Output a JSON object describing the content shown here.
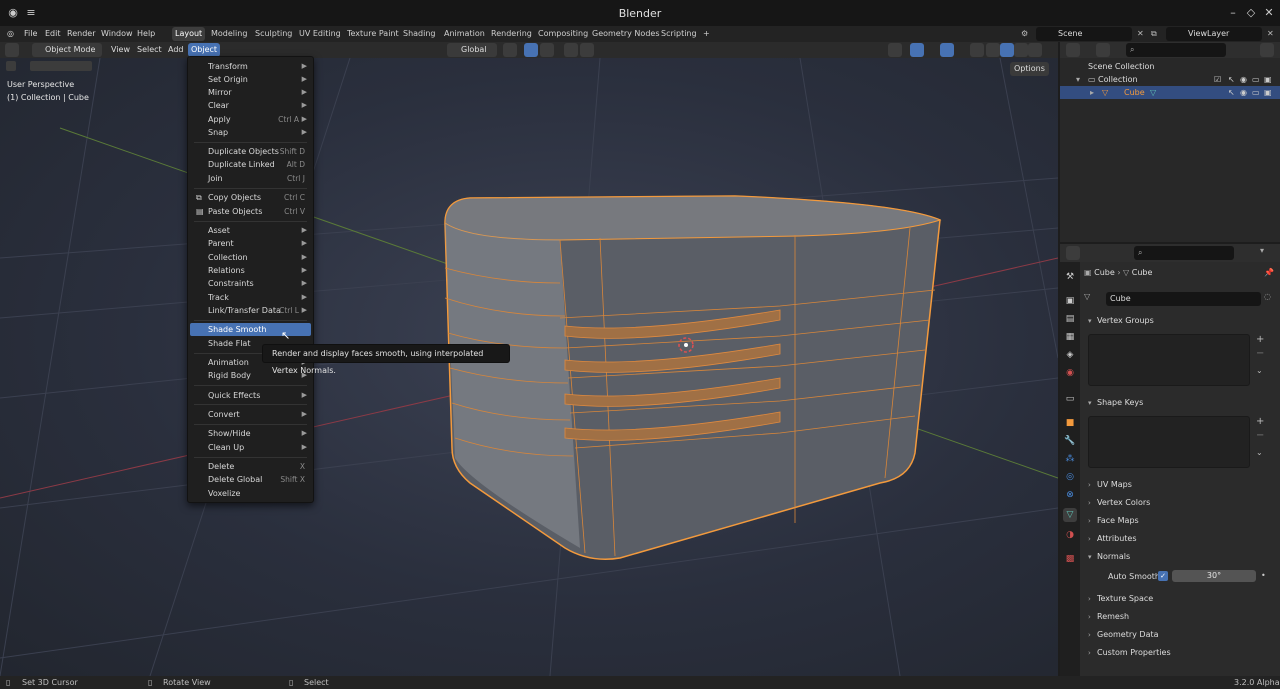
{
  "window": {
    "title": "Blender"
  },
  "menubar": {
    "items": [
      "File",
      "Edit",
      "Render",
      "Window",
      "Help"
    ],
    "workspaces": [
      "Layout",
      "Modeling",
      "Sculpting",
      "UV Editing",
      "Texture Paint",
      "Shading",
      "Animation",
      "Rendering",
      "Compositing",
      "Geometry Nodes",
      "Scripting"
    ],
    "active_workspace": "Layout",
    "add_tab": "+",
    "scene": "Scene",
    "view_layer": "ViewLayer"
  },
  "viewport_header": {
    "mode": "Object Mode",
    "menus": [
      "View",
      "Select",
      "Add",
      "Object"
    ],
    "active_menu": "Object",
    "orientation": "Global",
    "options": "Options"
  },
  "viewport": {
    "perspective": "User Perspective",
    "context": "(1) Collection | Cube"
  },
  "object_menu": {
    "items": [
      {
        "label": "Transform",
        "shortcut": "",
        "submenu": true
      },
      {
        "label": "Set Origin",
        "shortcut": "",
        "submenu": true
      },
      {
        "label": "Mirror",
        "shortcut": "",
        "submenu": true
      },
      {
        "label": "Clear",
        "shortcut": "",
        "submenu": true
      },
      {
        "label": "Apply",
        "shortcut": "Ctrl A",
        "submenu": true
      },
      {
        "label": "Snap",
        "shortcut": "",
        "submenu": true
      },
      {
        "label": "Duplicate Objects",
        "shortcut": "Shift D",
        "submenu": false
      },
      {
        "label": "Duplicate Linked",
        "shortcut": "Alt D",
        "submenu": false
      },
      {
        "label": "Join",
        "shortcut": "Ctrl J",
        "submenu": false
      },
      {
        "label": "Copy Objects",
        "shortcut": "Ctrl C",
        "submenu": false
      },
      {
        "label": "Paste Objects",
        "shortcut": "Ctrl V",
        "submenu": false
      },
      {
        "label": "Asset",
        "shortcut": "",
        "submenu": true
      },
      {
        "label": "Parent",
        "shortcut": "",
        "submenu": true
      },
      {
        "label": "Collection",
        "shortcut": "",
        "submenu": true
      },
      {
        "label": "Relations",
        "shortcut": "",
        "submenu": true
      },
      {
        "label": "Constraints",
        "shortcut": "",
        "submenu": true
      },
      {
        "label": "Track",
        "shortcut": "",
        "submenu": true
      },
      {
        "label": "Link/Transfer Data",
        "shortcut": "Ctrl L",
        "submenu": true
      },
      {
        "label": "Shade Smooth",
        "shortcut": "",
        "submenu": false
      },
      {
        "label": "Shade Flat",
        "shortcut": "",
        "submenu": false
      },
      {
        "label": "Animation",
        "shortcut": "",
        "submenu": true
      },
      {
        "label": "Rigid Body",
        "shortcut": "",
        "submenu": true
      },
      {
        "label": "Quick Effects",
        "shortcut": "",
        "submenu": true
      },
      {
        "label": "Convert",
        "shortcut": "",
        "submenu": true
      },
      {
        "label": "Show/Hide",
        "shortcut": "",
        "submenu": true
      },
      {
        "label": "Clean Up",
        "shortcut": "",
        "submenu": true
      },
      {
        "label": "Delete",
        "shortcut": "X",
        "submenu": false
      },
      {
        "label": "Delete Global",
        "shortcut": "Shift X",
        "submenu": false
      },
      {
        "label": "Voxelize",
        "shortcut": "",
        "submenu": false
      }
    ],
    "highlighted": "Shade Smooth",
    "tooltip": "Render and display faces smooth, using interpolated Vertex Normals."
  },
  "outliner": {
    "root": "Scene Collection",
    "collection": "Collection",
    "object": "Cube"
  },
  "properties": {
    "breadcrumb_object": "Cube",
    "breadcrumb_data": "Cube",
    "mesh_name": "Cube",
    "panels": [
      "Vertex Groups",
      "Shape Keys",
      "UV Maps",
      "Vertex Colors",
      "Face Maps",
      "Attributes",
      "Normals",
      "Texture Space",
      "Remesh",
      "Geometry Data",
      "Custom Properties"
    ],
    "auto_smooth_label": "Auto Smooth",
    "auto_smooth_angle": "30°"
  },
  "statusbar": {
    "left": "Set 3D Cursor",
    "mid": "Rotate View",
    "right": "Select",
    "version": "3.2.0 Alpha"
  },
  "colors": {
    "accent": "#4772b3",
    "selection": "#f39a3d",
    "background": "#1d1d1d"
  }
}
